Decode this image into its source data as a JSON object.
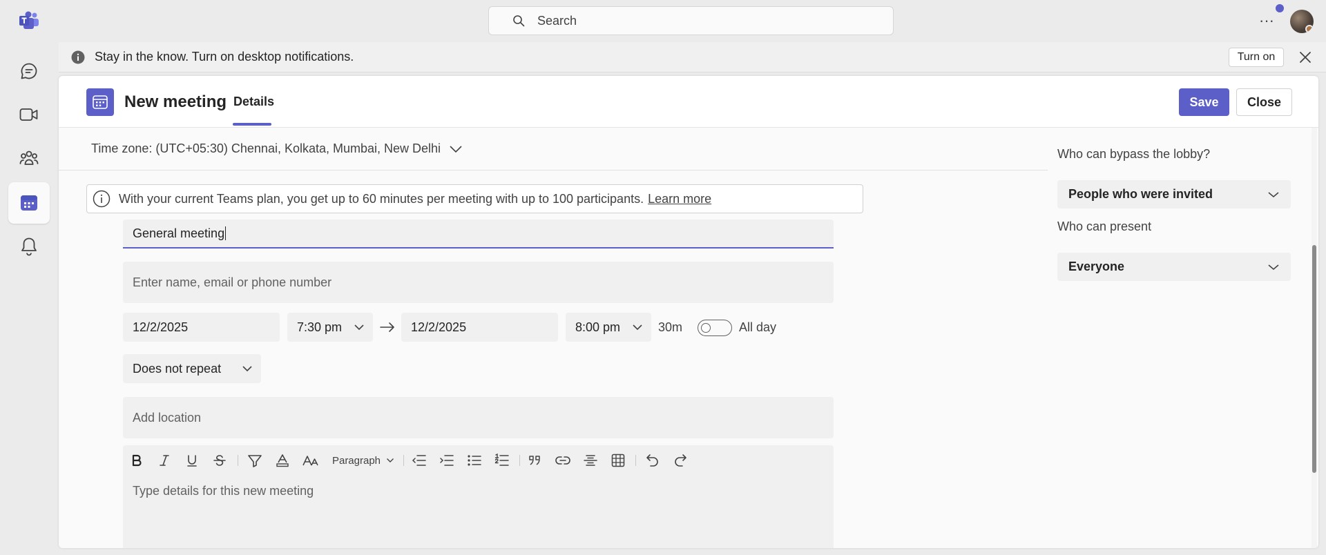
{
  "topbar": {
    "search_placeholder": "Search",
    "more_label": "···"
  },
  "notification": {
    "text": "Stay in the know. Turn on desktop notifications.",
    "turn_on_label": "Turn on"
  },
  "header": {
    "title": "New meeting",
    "tab_details": "Details",
    "save_label": "Save",
    "close_label": "Close"
  },
  "timezone": {
    "label": "Time zone: (UTC+05:30) Chennai, Kolkata, Mumbai, New Delhi"
  },
  "info": {
    "text": "With your current Teams plan, you get up to 60 minutes per meeting with up to 100 participants.",
    "link": "Learn more"
  },
  "form": {
    "title_value": "General meeting",
    "attendees_placeholder": "Enter name, email or phone number",
    "start_date": "12/2/2025",
    "start_time": "7:30 pm",
    "end_date": "12/2/2025",
    "end_time": "8:00 pm",
    "duration": "30m",
    "all_day_label": "All day",
    "all_day": false,
    "repeat": "Does not repeat",
    "location_placeholder": "Add location",
    "details_placeholder": "Type details for this new meeting",
    "paragraph_style": "Paragraph"
  },
  "options": {
    "lobby_label": "Who can bypass the lobby?",
    "lobby_value": "People who were invited",
    "present_label": "Who can present",
    "present_value": "Everyone"
  },
  "colors": {
    "accent": "#5b5fc7",
    "notification_dot": "#5b5fc7"
  }
}
